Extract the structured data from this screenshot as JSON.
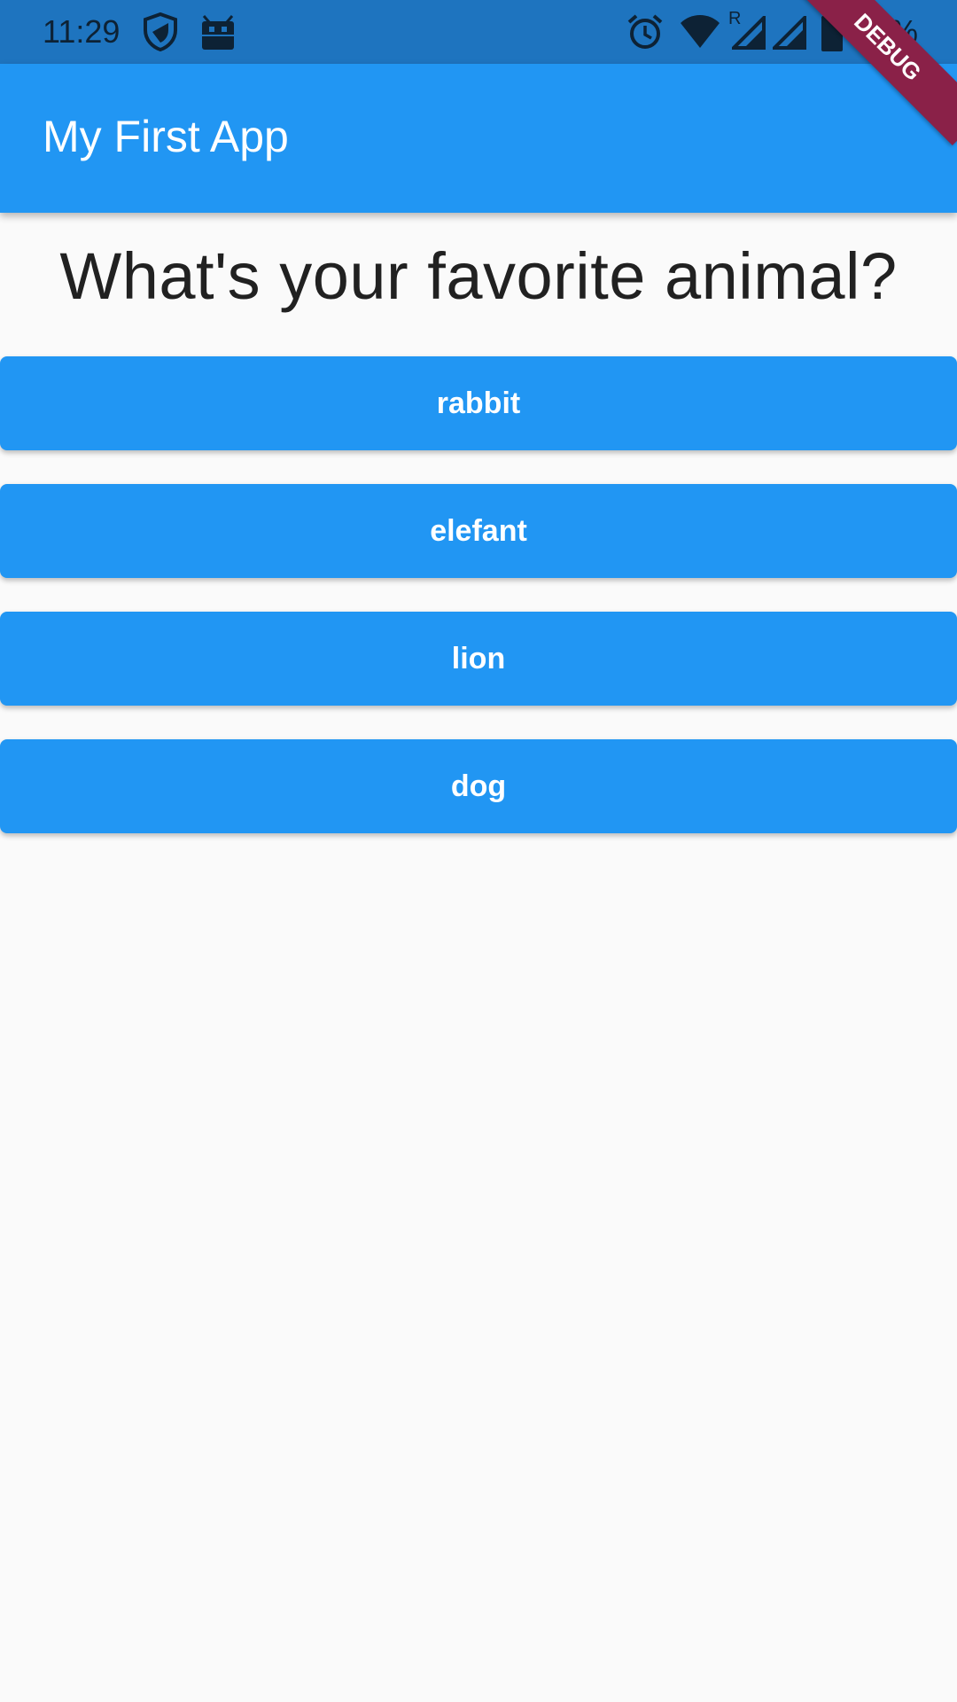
{
  "status_bar": {
    "time": "11:29",
    "battery_percent": "92%",
    "color": "#1e74bf",
    "icons": [
      "shield-icon",
      "android-icon",
      "alarm-icon",
      "wifi-icon",
      "cell-signal-icon",
      "cell-signal-icon",
      "battery-icon"
    ]
  },
  "app_bar": {
    "title": "My First App",
    "color": "#2196f3"
  },
  "question": {
    "text": "What's your favorite animal?"
  },
  "answers": [
    {
      "label": "rabbit"
    },
    {
      "label": "elefant"
    },
    {
      "label": "lion"
    },
    {
      "label": "dog"
    }
  ],
  "debug_banner": {
    "label": "DEBUG",
    "color": "#8a2148"
  }
}
